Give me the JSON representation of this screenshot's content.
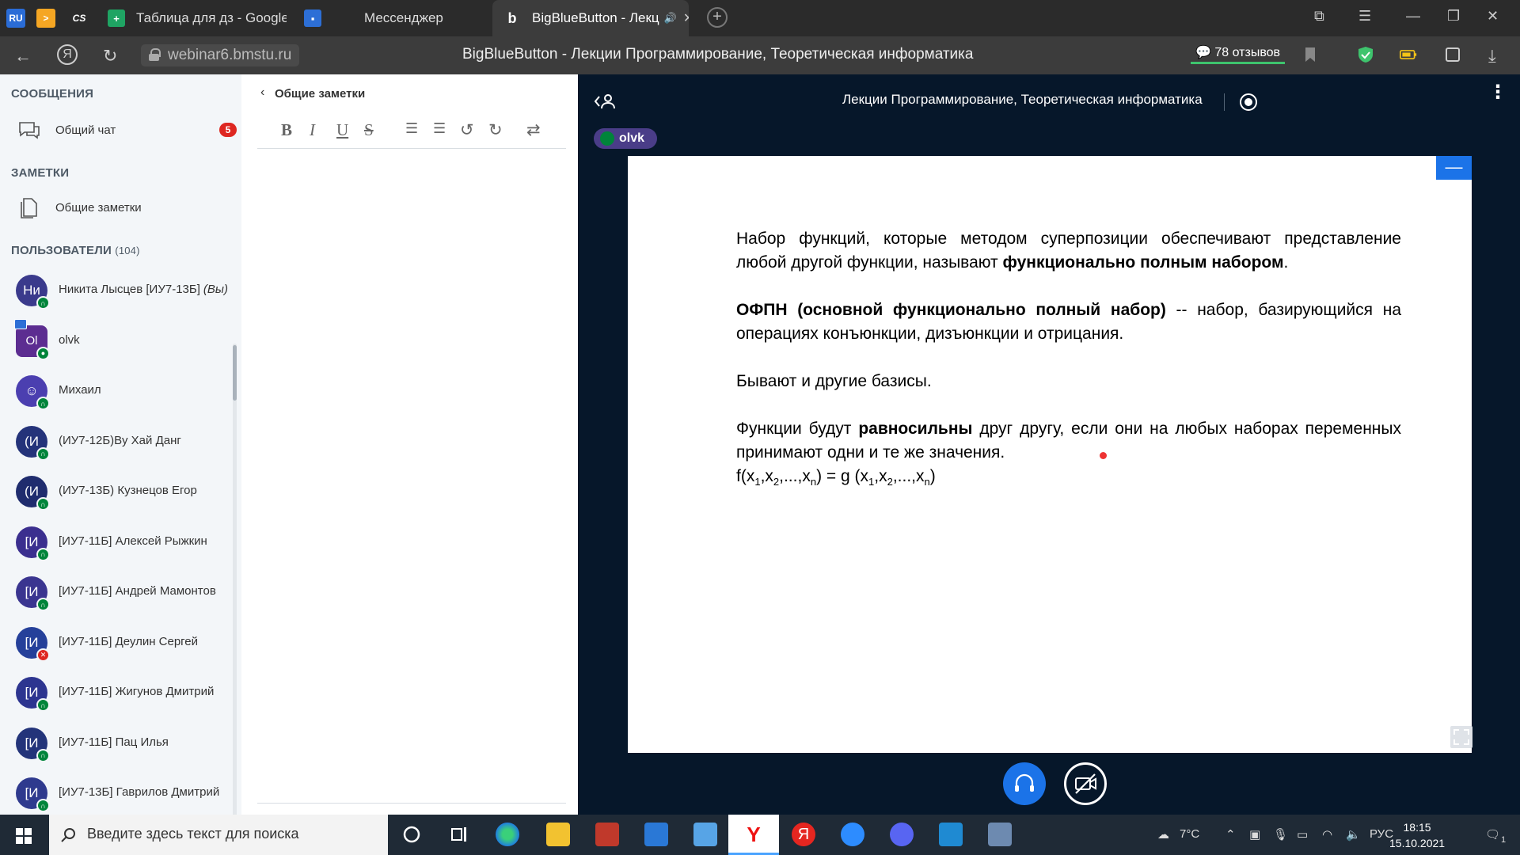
{
  "browser": {
    "tabs": [
      {
        "label": "Таблица для дз - Google Т",
        "icon": "google-sheets-icon"
      },
      {
        "label": "Мессенджер",
        "icon": "messenger-icon"
      },
      {
        "label": "BigBlueButton - Лекц",
        "icon": "bigbluebutton-icon",
        "active": true
      }
    ],
    "pinned": [
      {
        "label": "RU",
        "icon": "ru-favicon",
        "color": "#2a6cd6"
      },
      {
        "label": ">",
        "icon": "play-favicon",
        "color": "#f5a623"
      },
      {
        "label": "CS",
        "icon": "cs-favicon",
        "color": "#2b2b2b"
      }
    ],
    "url": "webinar6.bmstu.ru",
    "page_title": "BigBlueButton - Лекции Программирование, Теоретическая информатика",
    "reviews": "78 отзывов"
  },
  "sidebar": {
    "messages_title": "СООБЩЕНИЯ",
    "public_chat": "Общий чат",
    "unread": "5",
    "notes_title": "ЗАМЕТКИ",
    "shared_notes": "Общие заметки",
    "users_title": "ПОЛЬЗОВАТЕЛИ",
    "users_count": "(104)",
    "users": [
      {
        "initials": "Ни",
        "name": "Никита Лысцев [ИУ7-13Б]",
        "you": "(Вы)",
        "color": "#3a3a8c",
        "status": "headset"
      },
      {
        "initials": "Ol",
        "name": "olvk",
        "color": "#5c2d91",
        "status": "mic",
        "presenter": true
      },
      {
        "initials": "☺",
        "name": "Михаил",
        "color": "#4b3fb0",
        "status": "headset"
      },
      {
        "initials": "(И",
        "name": "(ИУ7-12Б)Ву Хай Данг",
        "color": "#24337a",
        "status": "headset"
      },
      {
        "initials": "(И",
        "name": "(ИУ7-13Б) Кузнецов Егор",
        "color": "#1f2c6e",
        "status": "headset"
      },
      {
        "initials": "[И",
        "name": "[ИУ7-11Б] Алексей Рыжкин",
        "color": "#3b2f8f",
        "status": "headset"
      },
      {
        "initials": "[И",
        "name": "[ИУ7-11Б] Андрей Мамонтов",
        "color": "#3a3590",
        "status": "headset"
      },
      {
        "initials": "[И",
        "name": "[ИУ7-11Б] Деулин Сергей",
        "color": "#25409a",
        "status": "muted"
      },
      {
        "initials": "[И",
        "name": "[ИУ7-11Б] Жигунов Дмитрий",
        "color": "#2d3590",
        "status": "headset"
      },
      {
        "initials": "[И",
        "name": "[ИУ7-11Б] Пац Илья",
        "color": "#23347a",
        "status": "headset"
      },
      {
        "initials": "[И",
        "name": "[ИУ7-13Б] Гаврилов Дмитрий",
        "color": "#2f3a8e",
        "status": "headset"
      }
    ]
  },
  "notes": {
    "title": "Общие заметки",
    "toolbar": [
      "B",
      "I",
      "U",
      "S",
      "ordered-list",
      "bullet-list",
      "undo",
      "redo",
      "swap"
    ]
  },
  "stage": {
    "title": "Лекции Программирование, Теоретическая информатика",
    "talker": "olvk"
  },
  "slide": {
    "p1_a": "Набор функций, которые методом суперпозиции обеспечивают представление любой другой функции, называют ",
    "p1_b": "функционально полным набором",
    "p1_c": ".",
    "p2_a": "ОФПН (основной функционально полный набор)",
    "p2_b": " -- набор, базирующийся на операциях конъюнкции, дизъюнкции и отрицания.",
    "p3": "Бывают и другие базисы.",
    "p4_a": "Функции будут ",
    "p4_b": "равносильны",
    "p4_c": " друг другу, если они на любых наборах переменных принимают одни и те же значения.",
    "f_f": "f(x",
    "f_comma": ",x",
    "f_dots": ",...,x",
    "f_close_eq": ") = g (x",
    "f_close": ")",
    "sub1": "1",
    "sub2": "2",
    "subn": "n"
  },
  "taskbar": {
    "search_placeholder": "Введите здесь текст для поиска",
    "weather": "7°C",
    "lang": "РУС",
    "time": "18:15",
    "date": "15.10.2021",
    "notif_count": "1"
  }
}
